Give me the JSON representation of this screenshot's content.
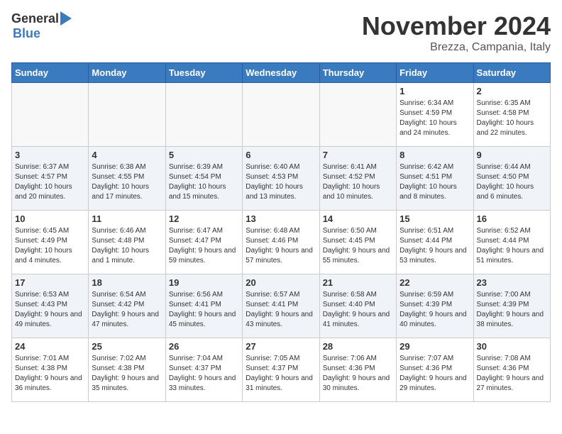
{
  "header": {
    "logo_general": "General",
    "logo_blue": "Blue",
    "month_title": "November 2024",
    "subtitle": "Brezza, Campania, Italy"
  },
  "days_of_week": [
    "Sunday",
    "Monday",
    "Tuesday",
    "Wednesday",
    "Thursday",
    "Friday",
    "Saturday"
  ],
  "weeks": [
    [
      {
        "day": "",
        "sunrise": "",
        "sunset": "",
        "daylight": ""
      },
      {
        "day": "",
        "sunrise": "",
        "sunset": "",
        "daylight": ""
      },
      {
        "day": "",
        "sunrise": "",
        "sunset": "",
        "daylight": ""
      },
      {
        "day": "",
        "sunrise": "",
        "sunset": "",
        "daylight": ""
      },
      {
        "day": "",
        "sunrise": "",
        "sunset": "",
        "daylight": ""
      },
      {
        "day": "1",
        "sunrise": "Sunrise: 6:34 AM",
        "sunset": "Sunset: 4:59 PM",
        "daylight": "Daylight: 10 hours and 24 minutes."
      },
      {
        "day": "2",
        "sunrise": "Sunrise: 6:35 AM",
        "sunset": "Sunset: 4:58 PM",
        "daylight": "Daylight: 10 hours and 22 minutes."
      }
    ],
    [
      {
        "day": "3",
        "sunrise": "Sunrise: 6:37 AM",
        "sunset": "Sunset: 4:57 PM",
        "daylight": "Daylight: 10 hours and 20 minutes."
      },
      {
        "day": "4",
        "sunrise": "Sunrise: 6:38 AM",
        "sunset": "Sunset: 4:55 PM",
        "daylight": "Daylight: 10 hours and 17 minutes."
      },
      {
        "day": "5",
        "sunrise": "Sunrise: 6:39 AM",
        "sunset": "Sunset: 4:54 PM",
        "daylight": "Daylight: 10 hours and 15 minutes."
      },
      {
        "day": "6",
        "sunrise": "Sunrise: 6:40 AM",
        "sunset": "Sunset: 4:53 PM",
        "daylight": "Daylight: 10 hours and 13 minutes."
      },
      {
        "day": "7",
        "sunrise": "Sunrise: 6:41 AM",
        "sunset": "Sunset: 4:52 PM",
        "daylight": "Daylight: 10 hours and 10 minutes."
      },
      {
        "day": "8",
        "sunrise": "Sunrise: 6:42 AM",
        "sunset": "Sunset: 4:51 PM",
        "daylight": "Daylight: 10 hours and 8 minutes."
      },
      {
        "day": "9",
        "sunrise": "Sunrise: 6:44 AM",
        "sunset": "Sunset: 4:50 PM",
        "daylight": "Daylight: 10 hours and 6 minutes."
      }
    ],
    [
      {
        "day": "10",
        "sunrise": "Sunrise: 6:45 AM",
        "sunset": "Sunset: 4:49 PM",
        "daylight": "Daylight: 10 hours and 4 minutes."
      },
      {
        "day": "11",
        "sunrise": "Sunrise: 6:46 AM",
        "sunset": "Sunset: 4:48 PM",
        "daylight": "Daylight: 10 hours and 1 minute."
      },
      {
        "day": "12",
        "sunrise": "Sunrise: 6:47 AM",
        "sunset": "Sunset: 4:47 PM",
        "daylight": "Daylight: 9 hours and 59 minutes."
      },
      {
        "day": "13",
        "sunrise": "Sunrise: 6:48 AM",
        "sunset": "Sunset: 4:46 PM",
        "daylight": "Daylight: 9 hours and 57 minutes."
      },
      {
        "day": "14",
        "sunrise": "Sunrise: 6:50 AM",
        "sunset": "Sunset: 4:45 PM",
        "daylight": "Daylight: 9 hours and 55 minutes."
      },
      {
        "day": "15",
        "sunrise": "Sunrise: 6:51 AM",
        "sunset": "Sunset: 4:44 PM",
        "daylight": "Daylight: 9 hours and 53 minutes."
      },
      {
        "day": "16",
        "sunrise": "Sunrise: 6:52 AM",
        "sunset": "Sunset: 4:44 PM",
        "daylight": "Daylight: 9 hours and 51 minutes."
      }
    ],
    [
      {
        "day": "17",
        "sunrise": "Sunrise: 6:53 AM",
        "sunset": "Sunset: 4:43 PM",
        "daylight": "Daylight: 9 hours and 49 minutes."
      },
      {
        "day": "18",
        "sunrise": "Sunrise: 6:54 AM",
        "sunset": "Sunset: 4:42 PM",
        "daylight": "Daylight: 9 hours and 47 minutes."
      },
      {
        "day": "19",
        "sunrise": "Sunrise: 6:56 AM",
        "sunset": "Sunset: 4:41 PM",
        "daylight": "Daylight: 9 hours and 45 minutes."
      },
      {
        "day": "20",
        "sunrise": "Sunrise: 6:57 AM",
        "sunset": "Sunset: 4:41 PM",
        "daylight": "Daylight: 9 hours and 43 minutes."
      },
      {
        "day": "21",
        "sunrise": "Sunrise: 6:58 AM",
        "sunset": "Sunset: 4:40 PM",
        "daylight": "Daylight: 9 hours and 41 minutes."
      },
      {
        "day": "22",
        "sunrise": "Sunrise: 6:59 AM",
        "sunset": "Sunset: 4:39 PM",
        "daylight": "Daylight: 9 hours and 40 minutes."
      },
      {
        "day": "23",
        "sunrise": "Sunrise: 7:00 AM",
        "sunset": "Sunset: 4:39 PM",
        "daylight": "Daylight: 9 hours and 38 minutes."
      }
    ],
    [
      {
        "day": "24",
        "sunrise": "Sunrise: 7:01 AM",
        "sunset": "Sunset: 4:38 PM",
        "daylight": "Daylight: 9 hours and 36 minutes."
      },
      {
        "day": "25",
        "sunrise": "Sunrise: 7:02 AM",
        "sunset": "Sunset: 4:38 PM",
        "daylight": "Daylight: 9 hours and 35 minutes."
      },
      {
        "day": "26",
        "sunrise": "Sunrise: 7:04 AM",
        "sunset": "Sunset: 4:37 PM",
        "daylight": "Daylight: 9 hours and 33 minutes."
      },
      {
        "day": "27",
        "sunrise": "Sunrise: 7:05 AM",
        "sunset": "Sunset: 4:37 PM",
        "daylight": "Daylight: 9 hours and 31 minutes."
      },
      {
        "day": "28",
        "sunrise": "Sunrise: 7:06 AM",
        "sunset": "Sunset: 4:36 PM",
        "daylight": "Daylight: 9 hours and 30 minutes."
      },
      {
        "day": "29",
        "sunrise": "Sunrise: 7:07 AM",
        "sunset": "Sunset: 4:36 PM",
        "daylight": "Daylight: 9 hours and 29 minutes."
      },
      {
        "day": "30",
        "sunrise": "Sunrise: 7:08 AM",
        "sunset": "Sunset: 4:36 PM",
        "daylight": "Daylight: 9 hours and 27 minutes."
      }
    ]
  ]
}
